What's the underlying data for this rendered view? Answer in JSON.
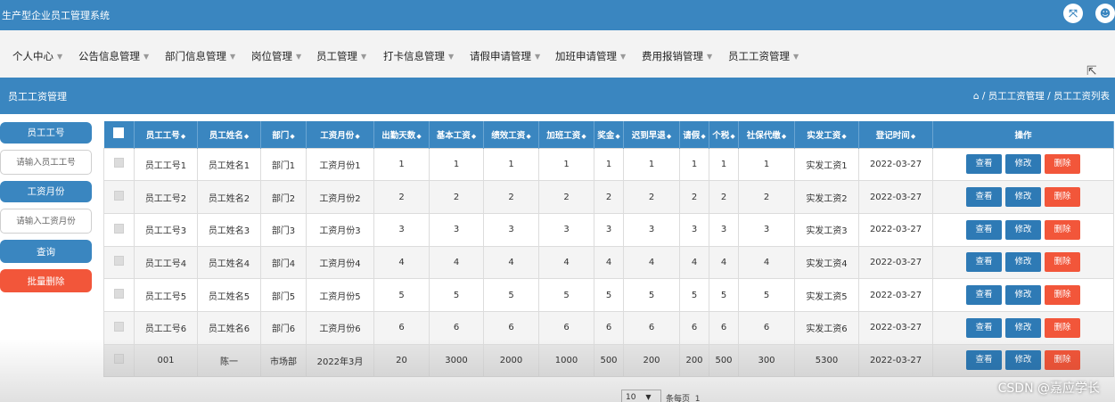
{
  "app": {
    "title": "生产型企业员工管理系统"
  },
  "header_icons": [
    "fullscreen-icon",
    "user-icon"
  ],
  "nav": {
    "items": [
      {
        "label": "个人中心"
      },
      {
        "label": "公告信息管理"
      },
      {
        "label": "部门信息管理"
      },
      {
        "label": "岗位管理"
      },
      {
        "label": "员工管理"
      },
      {
        "label": "打卡信息管理"
      },
      {
        "label": "请假申请管理"
      },
      {
        "label": "加班申请管理"
      },
      {
        "label": "费用报销管理"
      },
      {
        "label": "员工工资管理"
      }
    ]
  },
  "page": {
    "title": "员工工资管理",
    "breadcrumb": " / 员工工资管理 / 员工工资列表"
  },
  "search": {
    "emp_no_label": "员工工号",
    "emp_no_placeholder": "请输入员工工号",
    "month_label": "工资月份",
    "month_placeholder": "请输入工资月份",
    "query_button": "查询",
    "batch_delete_button": "批量删除"
  },
  "table": {
    "headers": [
      "员工工号",
      "员工姓名",
      "部门",
      "工资月份",
      "出勤天数",
      "基本工资",
      "绩效工资",
      "加班工资",
      "奖金",
      "迟到早退",
      "请假",
      "个税",
      "社保代缴",
      "实发工资",
      "登记时间",
      "操作"
    ],
    "rows": [
      [
        "员工工号1",
        "员工姓名1",
        "部门1",
        "工资月份1",
        "1",
        "1",
        "1",
        "1",
        "1",
        "1",
        "1",
        "1",
        "1",
        "实发工资1",
        "2022-03-27"
      ],
      [
        "员工工号2",
        "员工姓名2",
        "部门2",
        "工资月份2",
        "2",
        "2",
        "2",
        "2",
        "2",
        "2",
        "2",
        "2",
        "2",
        "实发工资2",
        "2022-03-27"
      ],
      [
        "员工工号3",
        "员工姓名3",
        "部门3",
        "工资月份3",
        "3",
        "3",
        "3",
        "3",
        "3",
        "3",
        "3",
        "3",
        "3",
        "实发工资3",
        "2022-03-27"
      ],
      [
        "员工工号4",
        "员工姓名4",
        "部门4",
        "工资月份4",
        "4",
        "4",
        "4",
        "4",
        "4",
        "4",
        "4",
        "4",
        "4",
        "实发工资4",
        "2022-03-27"
      ],
      [
        "员工工号5",
        "员工姓名5",
        "部门5",
        "工资月份5",
        "5",
        "5",
        "5",
        "5",
        "5",
        "5",
        "5",
        "5",
        "5",
        "实发工资5",
        "2022-03-27"
      ],
      [
        "员工工号6",
        "员工姓名6",
        "部门6",
        "工资月份6",
        "6",
        "6",
        "6",
        "6",
        "6",
        "6",
        "6",
        "6",
        "6",
        "实发工资6",
        "2022-03-27"
      ],
      [
        "001",
        "陈一",
        "市场部",
        "2022年3月",
        "20",
        "3000",
        "2000",
        "1000",
        "500",
        "200",
        "200",
        "500",
        "300",
        "5300",
        "2022-03-27"
      ]
    ],
    "actions": {
      "view": "查看",
      "edit": "修改",
      "delete": "删除"
    }
  },
  "pager": {
    "page_size": "10",
    "per_page_text": "条每页",
    "page_number": "1"
  },
  "watermark": "CSDN @嘉应学长",
  "colors": {
    "primary": "#3a86c0",
    "danger": "#f2563a",
    "nav_bg": "#f3f3f3"
  }
}
